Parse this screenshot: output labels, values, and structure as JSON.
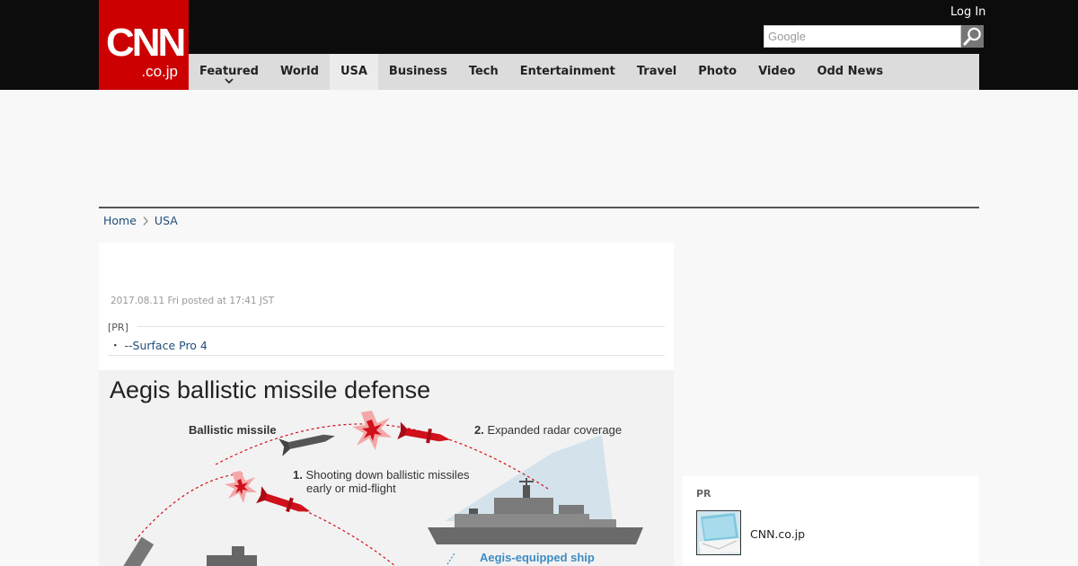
{
  "header": {
    "logo_main": "CNN",
    "logo_sub": ".co.jp",
    "login_label": "Log In",
    "search_placeholder": "Google"
  },
  "nav": {
    "items": [
      "Featured",
      "World",
      "USA",
      "Business",
      "Tech",
      "Entertainment",
      "Travel",
      "Photo",
      "Video",
      "Odd News"
    ],
    "active": "USA"
  },
  "breadcrumb": {
    "home": "Home",
    "section": "USA"
  },
  "article": {
    "timestamp": "2017.08.11 Fri posted at 17:41 JST",
    "pr_label": "[PR]",
    "pr_bullet": "・",
    "pr_link": "--Surface Pro 4"
  },
  "figure": {
    "title": "Aegis ballistic missile defense",
    "label_missile": "Ballistic missile",
    "label_radar_num": "2.",
    "label_radar": "Expanded radar coverage",
    "label_shoot_num": "1.",
    "label_shoot_line1": "Shooting down ballistic missiles",
    "label_shoot_line2": "early or mid-flight",
    "label_ship": "Aegis-equipped ship"
  },
  "sidebar": {
    "pr_label": "PR",
    "pr_text": "CNN.co.jp"
  },
  "colors": {
    "brand_red": "#cc0000",
    "topbar": "#0c0c0c",
    "nav_bg": "#dcdcdc",
    "link": "#1f4e79",
    "missile_red": "#d0101b",
    "ship_blue": "#3d8cc2"
  }
}
